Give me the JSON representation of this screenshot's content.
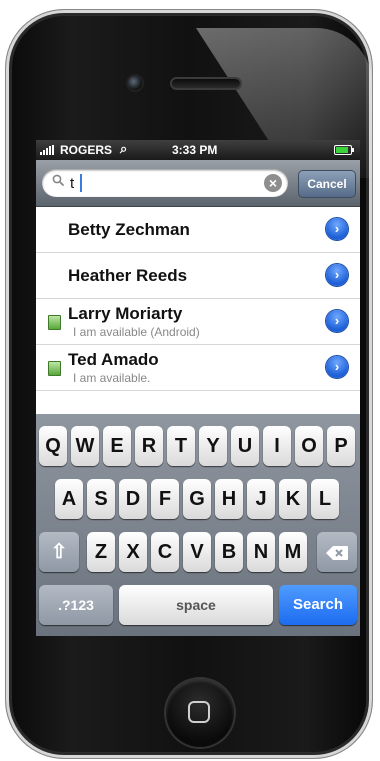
{
  "status_bar": {
    "carrier": "ROGERS",
    "time": "3:33 PM",
    "battery_level": 0.85
  },
  "search": {
    "value": "t",
    "cancel_label": "Cancel",
    "icon": "search-icon",
    "clear_icon": "clear-icon"
  },
  "results": [
    {
      "name": "Betty Zechman",
      "status": "",
      "online": false
    },
    {
      "name": "Heather Reeds",
      "status": "",
      "online": false
    },
    {
      "name": "Larry Moriarty",
      "status": "I am available (Android)",
      "online": true
    },
    {
      "name": "Ted Amado",
      "status": "I am available.",
      "online": true
    }
  ],
  "keyboard": {
    "row1": [
      "Q",
      "W",
      "E",
      "R",
      "T",
      "Y",
      "U",
      "I",
      "O",
      "P"
    ],
    "row2": [
      "A",
      "S",
      "D",
      "F",
      "G",
      "H",
      "J",
      "K",
      "L"
    ],
    "row3": [
      "Z",
      "X",
      "C",
      "V",
      "B",
      "N",
      "M"
    ],
    "mode_label": ".?123",
    "space_label": "space",
    "search_label": "Search",
    "shift_icon": "shift-icon",
    "delete_icon": "delete-icon"
  },
  "colors": {
    "accent": "#1d6cf0",
    "online": "#57a83a"
  }
}
